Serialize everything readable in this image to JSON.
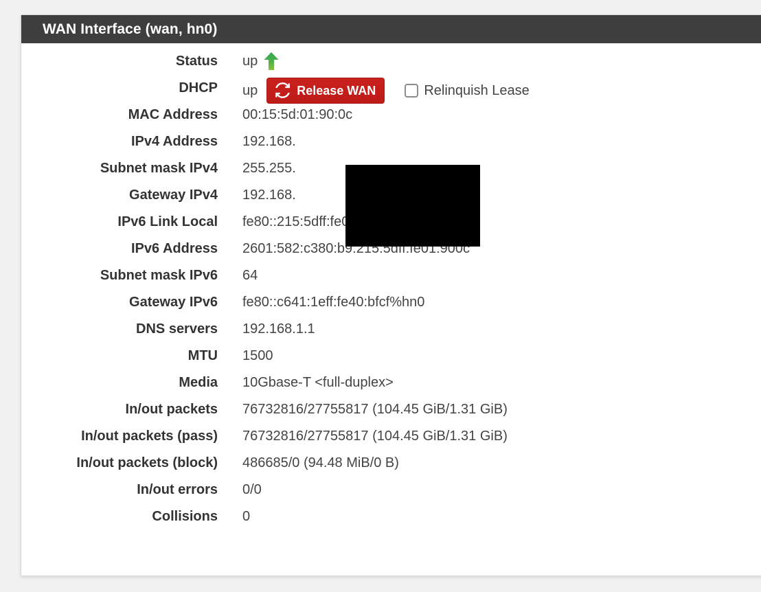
{
  "panel": {
    "title": "WAN Interface (wan, hn0)"
  },
  "status": {
    "label": "Status",
    "value": "up",
    "icon": "arrow-up-icon",
    "icon_color": "#3aaa35"
  },
  "dhcp": {
    "label": "DHCP",
    "value": "up",
    "release_button": {
      "label": "Release WAN",
      "icon": "refresh-icon",
      "color": "#c9211e"
    },
    "relinquish": {
      "label": "Relinquish Lease",
      "checked": false
    }
  },
  "rows": [
    {
      "label": "MAC Address",
      "value": "00:15:5d:01:90:0c"
    },
    {
      "label": "IPv4 Address",
      "value": "192.168."
    },
    {
      "label": "Subnet mask IPv4",
      "value": "255.255."
    },
    {
      "label": "Gateway IPv4",
      "value": "192.168."
    },
    {
      "label": "IPv6 Link Local",
      "value": "fe80::215:5dff:fe01:900c%hn0"
    },
    {
      "label": "IPv6 Address",
      "value": "2601:582:c380:b9:215:5dff:fe01:900c"
    },
    {
      "label": "Subnet mask IPv6",
      "value": "64"
    },
    {
      "label": "Gateway IPv6",
      "value": "fe80::c641:1eff:fe40:bfcf%hn0"
    },
    {
      "label": "DNS servers",
      "value": "192.168.1.1"
    },
    {
      "label": "MTU",
      "value": "1500"
    },
    {
      "label": "Media",
      "value": "10Gbase-T <full-duplex>"
    },
    {
      "label": "In/out packets",
      "value": "76732816/27755817 (104.45 GiB/1.31 GiB)"
    },
    {
      "label": "In/out packets (pass)",
      "value": "76732816/27755817 (104.45 GiB/1.31 GiB)"
    },
    {
      "label": "In/out packets (block)",
      "value": "486685/0 (94.48 MiB/0 B)"
    },
    {
      "label": "In/out errors",
      "value": "0/0"
    },
    {
      "label": "Collisions",
      "value": "0"
    }
  ]
}
